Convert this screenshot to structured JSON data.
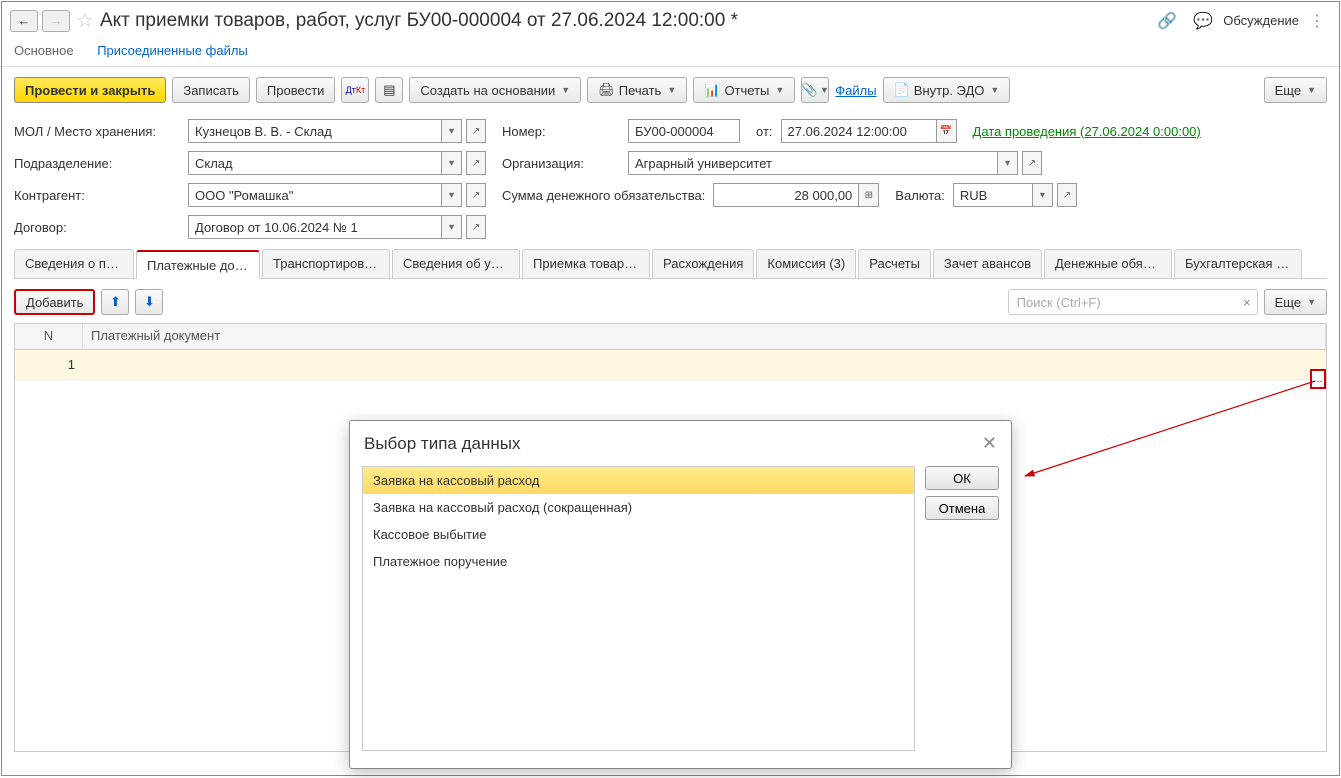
{
  "title": "Акт приемки товаров, работ, услуг БУ00-000004 от 27.06.2024 12:00:00 *",
  "discuss": "Обсуждение",
  "nav": {
    "main": "Основное",
    "files": "Присоединенные файлы"
  },
  "toolbar": {
    "postClose": "Провести и закрыть",
    "save": "Записать",
    "post": "Провести",
    "createBase": "Создать на основании",
    "print": "Печать",
    "reports": "Отчеты",
    "files": "Файлы",
    "edo": "Внутр. ЭДО",
    "more": "Еще"
  },
  "form": {
    "mol_label": "МОЛ / Место хранения:",
    "mol_value": "Кузнецов В. В. - Склад",
    "num_label": "Номер:",
    "num_value": "БУ00-000004",
    "from": "от:",
    "date_value": "27.06.2024 12:00:00",
    "date_link": "Дата проведения (27.06.2024 0:00:00)",
    "dept_label": "Подразделение:",
    "dept_value": "Склад",
    "org_label": "Организация:",
    "org_value": "Аграрный университет",
    "contractor_label": "Контрагент:",
    "contractor_value": "ООО \"Ромашка\"",
    "sum_label": "Сумма денежного обязательства:",
    "sum_value": "28 000,00",
    "currency_label": "Валюта:",
    "currency_value": "RUB",
    "contract_label": "Договор:",
    "contract_value": "Договор от 10.06.2024 № 1"
  },
  "tabs": [
    "Сведения о пост...",
    "Платежные доку...",
    "Транспортировка ...",
    "Сведения об упа...",
    "Приемка товаров...",
    "Расхождения",
    "Комиссия (3)",
    "Расчеты",
    "Зачет авансов",
    "Денежные обязат...",
    "Бухгалтерская оп..."
  ],
  "subtoolbar": {
    "add": "Добавить",
    "searchPlaceholder": "Поиск (Ctrl+F)",
    "more": "Еще"
  },
  "table": {
    "h_n": "N",
    "h_doc": "Платежный документ",
    "row_n": "1",
    "ellipsis": "..."
  },
  "dialog": {
    "title": "Выбор типа данных",
    "items": [
      "Заявка на кассовый расход",
      "Заявка на кассовый расход (сокращенная)",
      "Кассовое выбытие",
      "Платежное поручение"
    ],
    "ok": "ОК",
    "cancel": "Отмена"
  }
}
